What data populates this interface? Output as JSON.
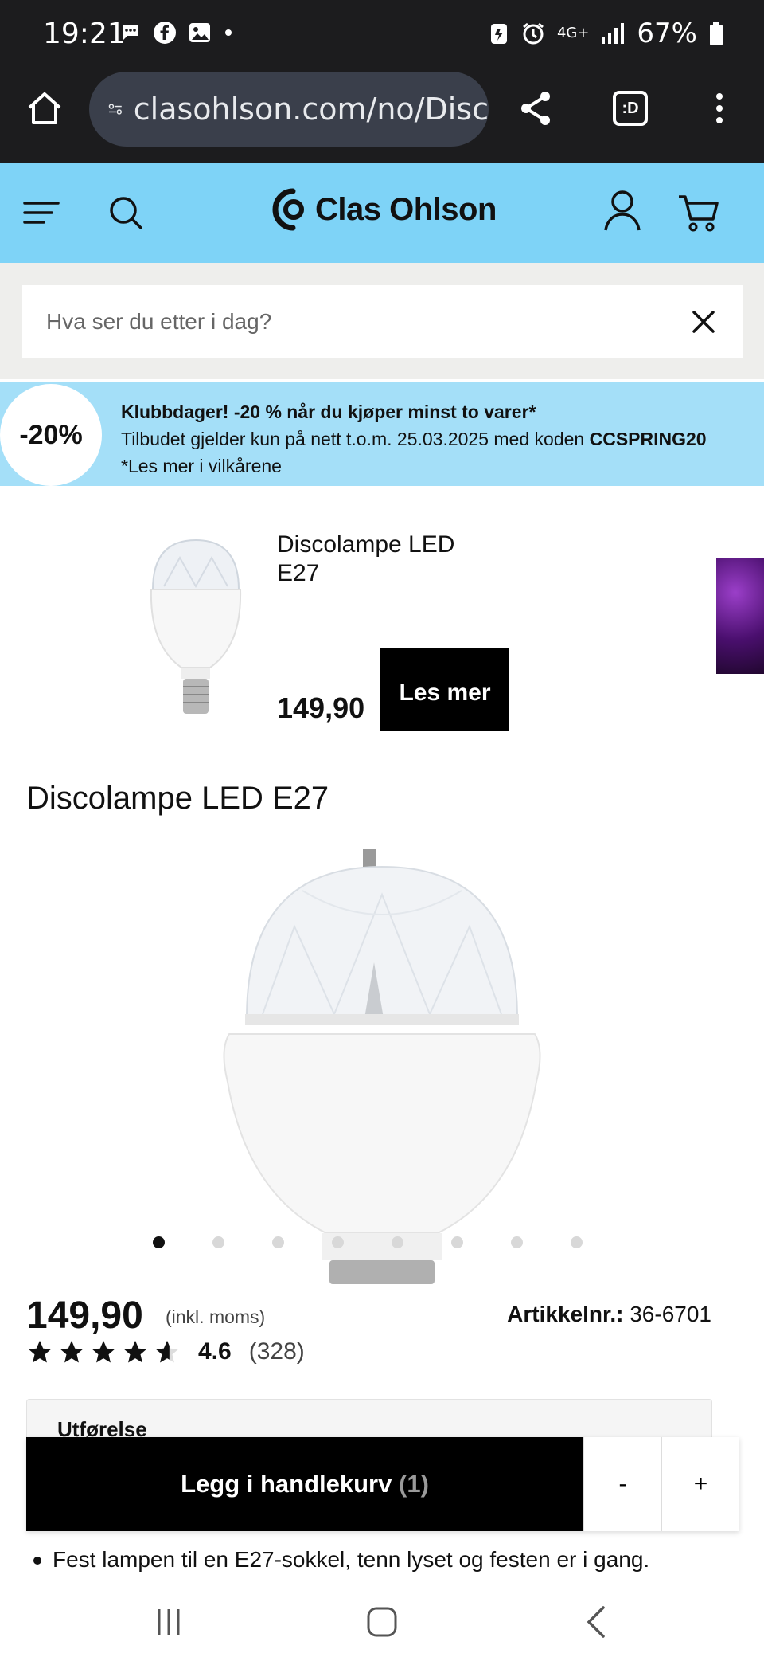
{
  "status_bar": {
    "time": "19:21",
    "network": "4G+",
    "battery": "67%"
  },
  "browser": {
    "url": "clasohlson.com/no/Disc",
    "tab_switcher_label": ":D"
  },
  "header": {
    "logo_text": "Clas Ohlson"
  },
  "search": {
    "placeholder": "Hva ser du etter i dag?"
  },
  "promo": {
    "badge": "-20%",
    "title": "Klubbdager! -20 % når du kjøper minst to varer*",
    "line1_prefix": "Tilbudet gjelder kun på nett t.o.m. 25.03.2025 med koden ",
    "code": "CCSPRING20",
    "line2": "*Les mer i vilkårene"
  },
  "recommended": {
    "name": "Discolampe LED E27",
    "price": "149,90",
    "button_label": "Les mer"
  },
  "product": {
    "title": "Discolampe LED E27",
    "image_count": 8,
    "active_image": 1,
    "price": "149,90",
    "price_note": "(inkl. moms)",
    "article_label": "Artikkelnr.:",
    "article_number": "36-6701",
    "rating": "4.6",
    "rating_count": "(328)",
    "variant_label": "Utførelse",
    "bullet_text": "Fest lampen til en E27-sokkel, tenn lyset og festen er i gang."
  },
  "cart_bar": {
    "add_label": "Legg i handlekurv",
    "count": "(1)",
    "minus": "-",
    "plus": "+"
  },
  "colors": {
    "header_bg": "#7ed3f7",
    "promo_bg": "#a4dff8",
    "primary_button": "#000000"
  }
}
